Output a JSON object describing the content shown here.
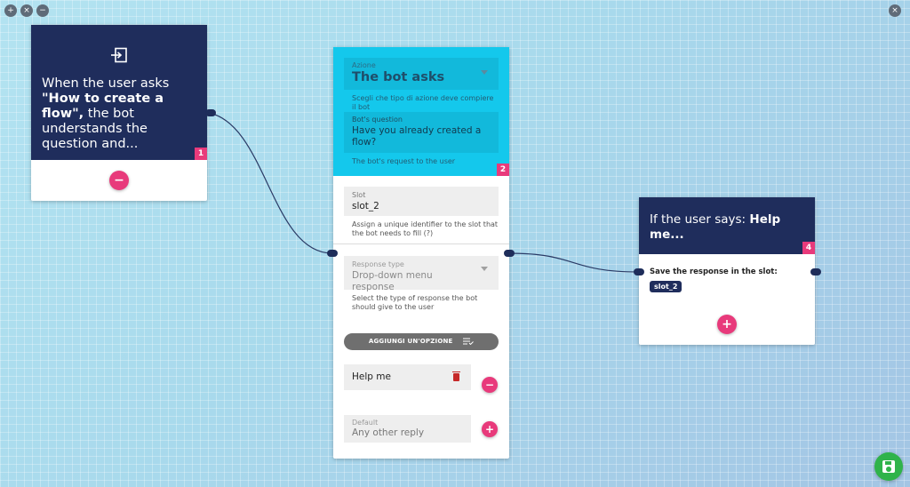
{
  "canvas": {
    "zoom_in_label": "+",
    "reset_label": "×",
    "zoom_out_label": "−",
    "close_label": "×"
  },
  "trigger_card": {
    "line1": "When the user asks",
    "bold": "\"How to create a flow\",",
    "line2": " the bot understands the question and...",
    "number": "1",
    "remove_label": "−"
  },
  "ask_card": {
    "action_label": "Azione",
    "action_value": "The bot asks",
    "action_hint": "Scegli che tipo di azione deve compiere il bot",
    "question_label": "Bot's question",
    "question_value": "Have you already created a flow?",
    "question_hint": "The bot's request to the user",
    "number": "2",
    "slot_label": "Slot",
    "slot_value": "slot_2",
    "slot_hint": "Assign a unique identifier to the slot that the bot needs to fill (?)",
    "response_type_label": "Response type",
    "response_type_value": "Drop-down menu response",
    "response_type_hint": "Select the type of response the bot should give to the user",
    "add_option_label": "AGGIUNGI UN'OPZIONE",
    "option_value": "Help me",
    "option_remove_label": "−",
    "default_label": "Default",
    "default_value": "Any other reply",
    "default_add_label": "+"
  },
  "reply_card": {
    "prefix": "If the user says: ",
    "bold": "Help me...",
    "number": "4",
    "save_label": "Save the response in the slot:",
    "slot_tag": "slot_2",
    "add_label": "+"
  },
  "colors": {
    "navy": "#1f2d5c",
    "cyan": "#14c8ec",
    "pink": "#e83a7b",
    "green": "#2fb34a"
  }
}
